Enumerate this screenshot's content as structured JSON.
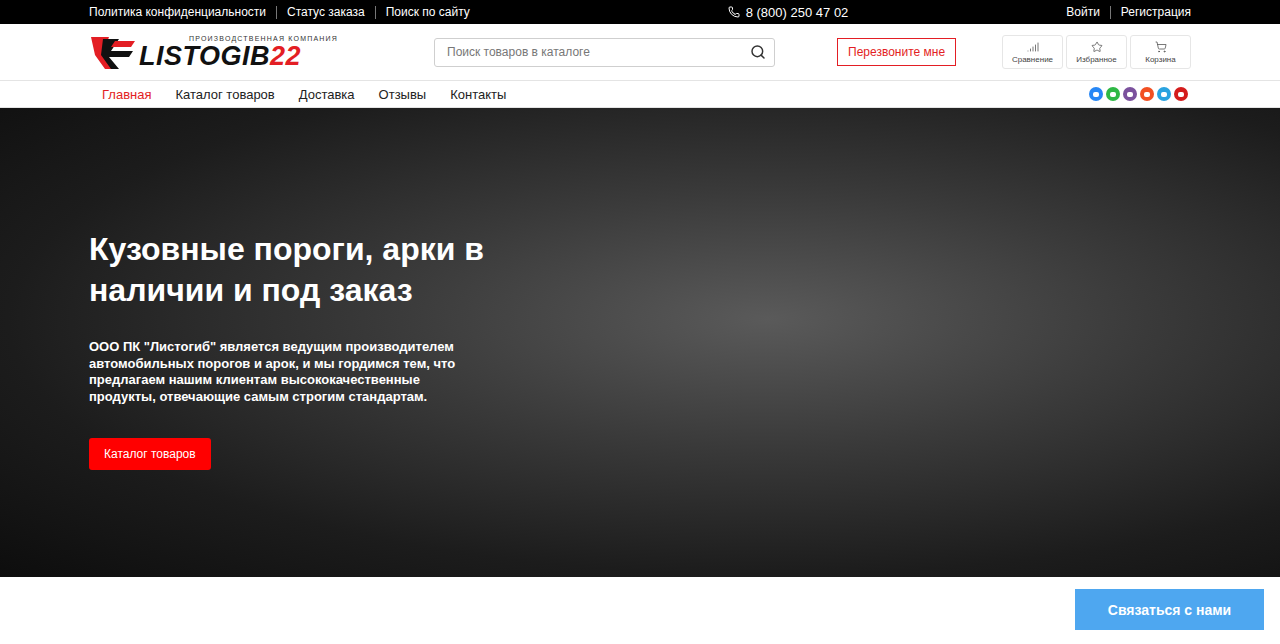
{
  "top_bar": {
    "links": [
      "Политика конфиденциальности",
      "Статус заказа",
      "Поиск по сайту"
    ],
    "phone": "8 (800) 250 47 02",
    "auth": [
      "Войти",
      "Регистрация"
    ]
  },
  "logo": {
    "tagline": "ПРОИЗВОДСТВЕННАЯ КОМПАНИЯ",
    "name": "LISTOGIB",
    "number": "22"
  },
  "search": {
    "placeholder": "Поиск товаров в каталоге"
  },
  "callback_button": "Перезвоните мне",
  "header_actions": [
    {
      "label": "Сравнение",
      "kind": "compare"
    },
    {
      "label": "Избранное",
      "kind": "favorites"
    },
    {
      "label": "Корзина",
      "kind": "cart"
    }
  ],
  "nav": [
    {
      "label": "Главная",
      "selected": true
    },
    {
      "label": "Каталог товаров",
      "selected": false
    },
    {
      "label": "Доставка",
      "selected": false
    },
    {
      "label": "Отзывы",
      "selected": false
    },
    {
      "label": "Контакты",
      "selected": false
    }
  ],
  "social": [
    {
      "color": "#2787f5"
    },
    {
      "color": "#2fb845"
    },
    {
      "color": "#7b519d"
    },
    {
      "color": "#f25022"
    },
    {
      "color": "#2aa3e0"
    },
    {
      "color": "#d41c1c"
    }
  ],
  "hero": {
    "title": "Кузовные пороги, арки в наличии и под заказ",
    "text": "ООО ПК \"Листогиб\" является ведущим производителем автомобильных порогов и арок, и мы гордимся тем, что предлагаем нашим клиентам высококачественные продукты, отвечающие самым строгим стандартам.",
    "button": "Каталог товаров"
  },
  "contact_button": "Связаться с нами"
}
